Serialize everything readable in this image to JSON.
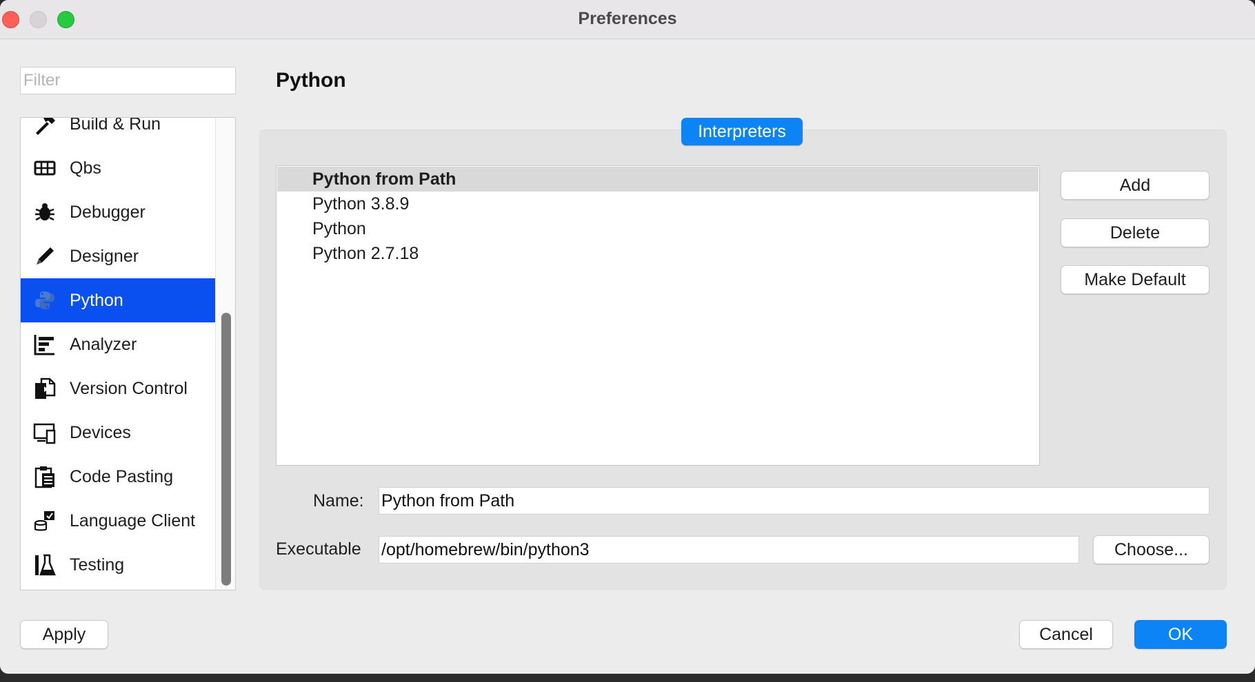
{
  "window": {
    "title": "Preferences"
  },
  "filter": {
    "placeholder": "Filter",
    "value": ""
  },
  "sidebar": {
    "selected_index": 4,
    "items": [
      {
        "label": "Build & Run",
        "icon": "hammer-icon"
      },
      {
        "label": "Qbs",
        "icon": "grid-icon"
      },
      {
        "label": "Debugger",
        "icon": "bug-icon"
      },
      {
        "label": "Designer",
        "icon": "pencil-icon"
      },
      {
        "label": "Python",
        "icon": "python-icon"
      },
      {
        "label": "Analyzer",
        "icon": "analyzer-icon"
      },
      {
        "label": "Version Control",
        "icon": "version-control-icon"
      },
      {
        "label": "Devices",
        "icon": "devices-icon"
      },
      {
        "label": "Code Pasting",
        "icon": "clipboard-icon"
      },
      {
        "label": "Language Client",
        "icon": "language-client-icon"
      },
      {
        "label": "Testing",
        "icon": "testing-icon"
      }
    ]
  },
  "page": {
    "title": "Python",
    "tab_label": "Interpreters",
    "interpreters": [
      {
        "name": "Python from Path",
        "is_default": true
      },
      {
        "name": "Python 3.8.9",
        "is_default": false
      },
      {
        "name": "Python",
        "is_default": false
      },
      {
        "name": "Python 2.7.18",
        "is_default": false
      }
    ],
    "buttons": {
      "add": "Add",
      "delete": "Delete",
      "make_default": "Make Default",
      "choose": "Choose..."
    },
    "name_label": "Name:",
    "name_value": "Python from Path",
    "executable_label": "Executable",
    "executable_value": "/opt/homebrew/bin/python3"
  },
  "footer": {
    "apply": "Apply",
    "cancel": "Cancel",
    "ok": "OK"
  },
  "colors": {
    "accent": "#0d84f6",
    "selection": "#0a4ff0"
  }
}
